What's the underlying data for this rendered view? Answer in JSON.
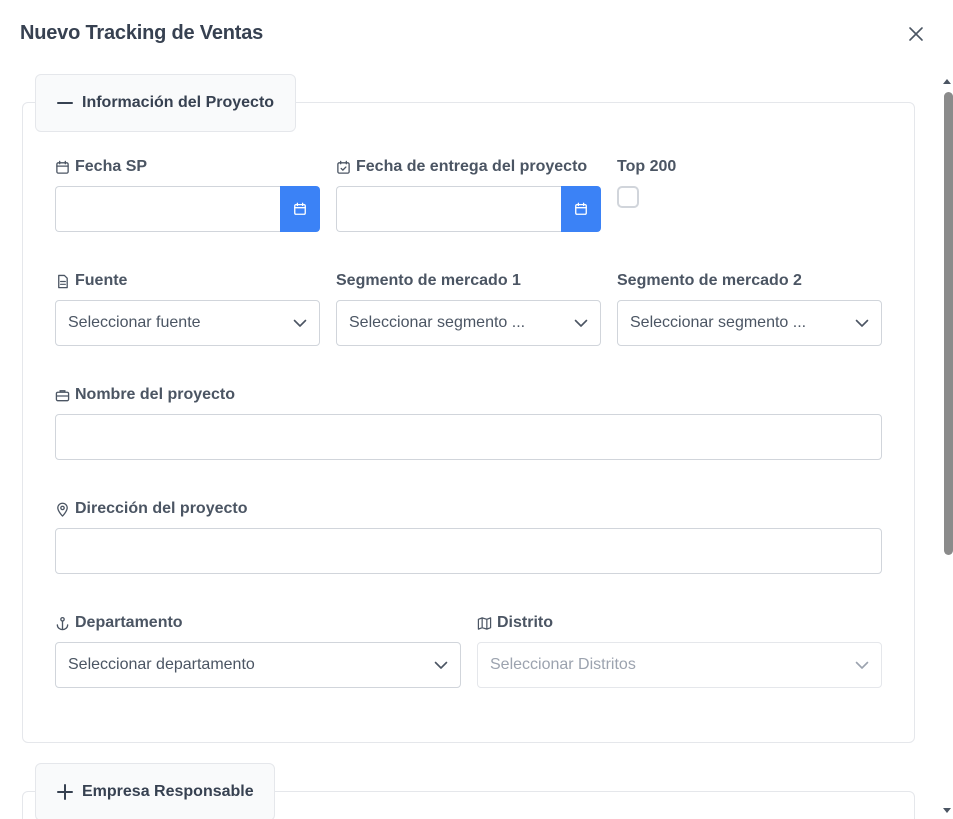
{
  "dialog": {
    "title": "Nuevo Tracking de Ventas"
  },
  "sections": {
    "project_info": {
      "title": "Información del Proyecto",
      "toggle": "collapse"
    },
    "company": {
      "title": "Empresa Responsable",
      "toggle": "expand"
    }
  },
  "fields": {
    "fecha_sp": {
      "label": "Fecha SP",
      "value": ""
    },
    "fecha_entrega": {
      "label": "Fecha de entrega del proyecto",
      "value": ""
    },
    "top200": {
      "label": "Top 200",
      "checked": false
    },
    "fuente": {
      "label": "Fuente",
      "placeholder": "Seleccionar fuente"
    },
    "segmento1": {
      "label": "Segmento de mercado 1",
      "placeholder": "Seleccionar segmento ..."
    },
    "segmento2": {
      "label": "Segmento de mercado 2",
      "placeholder": "Seleccionar segmento ..."
    },
    "nombre": {
      "label": "Nombre del proyecto",
      "value": ""
    },
    "direccion": {
      "label": "Dirección del proyecto",
      "value": ""
    },
    "departamento": {
      "label": "Departamento",
      "placeholder": "Seleccionar departamento"
    },
    "distrito": {
      "label": "Distrito",
      "placeholder": "Seleccionar Distritos",
      "disabled": true
    }
  },
  "colors": {
    "accent": "#3b82f6",
    "text": "#374151",
    "border": "#d1d5db",
    "disabled_text": "#9ca3af"
  },
  "icons": [
    "close-icon",
    "minus-icon",
    "plus-icon",
    "calendar-icon",
    "calendar-check-icon",
    "file-text-icon",
    "briefcase-icon",
    "map-pin-icon",
    "anchor-icon",
    "map-icon",
    "chevron-down-icon"
  ]
}
